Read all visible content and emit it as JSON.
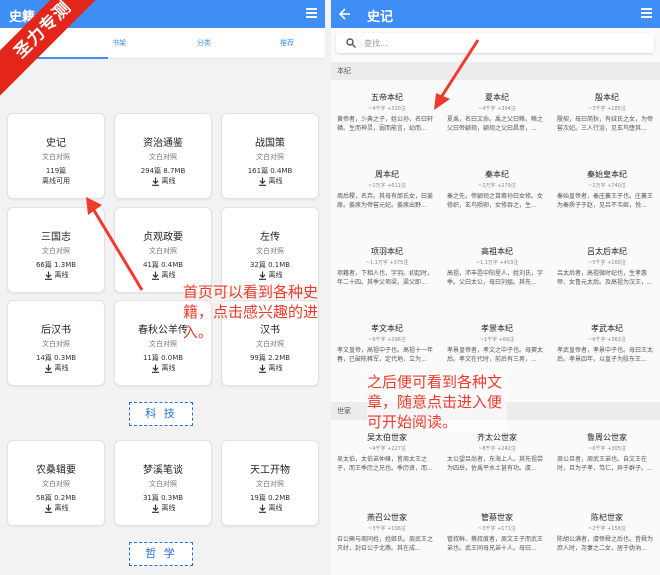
{
  "left": {
    "title": "史籍",
    "tabs": [
      "书架",
      "分类",
      "推荐"
    ],
    "banner": "圣力专测",
    "cards": [
      {
        "title": "史记",
        "sub": "文白对照",
        "size": "119篇",
        "status": "离线可用"
      },
      {
        "title": "资治通鉴",
        "sub": "文白对照",
        "size": "294篇 8.7MB",
        "status": "离线"
      },
      {
        "title": "战国策",
        "sub": "文白对照",
        "size": "161篇 0.4MB",
        "status": "离线"
      },
      {
        "title": "三国志",
        "sub": "文白对照",
        "size": "66篇 1.3MB",
        "status": "离线"
      },
      {
        "title": "贞观政要",
        "sub": "文白对照",
        "size": "41篇 0.4MB",
        "status": "离线"
      },
      {
        "title": "左传",
        "sub": "文白对照",
        "size": "32篇 0.1MB",
        "status": "离线"
      },
      {
        "title": "后汉书",
        "sub": "文白对照",
        "size": "14篇 0.3MB",
        "status": "离线"
      },
      {
        "title": "春秋公羊传",
        "sub": "文白对照",
        "size": "11篇 0.0MB",
        "status": "离线"
      },
      {
        "title": "汉书",
        "sub": "文白对照",
        "size": "99篇 2.2MB",
        "status": "离线"
      },
      {
        "title": "农桑辑要",
        "sub": "文白对照",
        "size": "58篇 0.2MB",
        "status": "离线"
      },
      {
        "title": "梦溪笔谈",
        "sub": "文白对照",
        "size": "31篇 0.3MB",
        "status": "离线"
      },
      {
        "title": "天工开物",
        "sub": "文白对照",
        "size": "19篇 0.2MB",
        "status": "离线"
      }
    ],
    "section_tech": "科 技",
    "section_phil": "哲 学",
    "annotation": "首页可以看到各种史籍，点击感兴趣的进入。"
  },
  "right": {
    "title": "史记",
    "search_placeholder": "查找...",
    "section_benji": "本纪",
    "section_shijia": "世家",
    "annotation": "之后便可看到各种文章，随意点击进入便可开始阅读。",
    "benji": [
      {
        "title": "五帝本纪",
        "meta": "~4千字 +320注",
        "excerpt": "黄帝者，少典之子，姓公孙，名曰轩辕。生而神灵，弱而能言，幼而..."
      },
      {
        "title": "夏本纪",
        "meta": "~4千字 +304注",
        "excerpt": "夏禹，名曰文命。禹之父曰鲧，鲧之父曰帝颛顼，颛顼之父曰昌意，..."
      },
      {
        "title": "殷本纪",
        "meta": "~3千字 +185注",
        "excerpt": "殷契，母曰简狄，有娀氏之女，为帝喾次妃。三人行浴，见玄鸟堕其..."
      },
      {
        "title": "周本纪",
        "meta": "~1万字 +611注",
        "excerpt": "周后稷，名弃。其母有邰氏女，曰姜原。姜原为帝喾元妃。姜原出野..."
      },
      {
        "title": "秦本纪",
        "meta": "~1万字 +279注",
        "excerpt": "秦之先，帝颛顼之苗裔孙曰女修。女修织，玄鸟陨卵，女修吞之，生..."
      },
      {
        "title": "秦始皇本纪",
        "meta": "~2万字 +740注",
        "excerpt": "秦始皇帝者，秦庄襄王子也。庄襄王为秦质子于赵，见吕不韦姬，悦..."
      },
      {
        "title": "项羽本纪",
        "meta": "~1.1万字 +375注",
        "excerpt": "项籍者，下相人也，字羽。初起时，年二十四。其季父项梁，梁父即..."
      },
      {
        "title": "高祖本纪",
        "meta": "~1.1万字 +453注",
        "excerpt": "高祖，沛丰邑中阳里人，姓刘氏，字季。父曰太公，母曰刘媪。其先..."
      },
      {
        "title": "吕太后本纪",
        "meta": "~5千字 +160注",
        "excerpt": "吕太后者，高祖微时妃也，生孝惠帝、女鲁元太后。及高祖为汉王，..."
      },
      {
        "title": "孝文本纪",
        "meta": "~6千字 +296注",
        "excerpt": "孝文皇帝，高祖中子也。高祖十一年春，已破陈豨军，定代地，立为..."
      },
      {
        "title": "孝景本纪",
        "meta": "~1千字 +66注",
        "excerpt": "孝景皇帝者，孝文之中子也。母窦太后。孝文在代时，前后有三男，..."
      },
      {
        "title": "孝武本纪",
        "meta": "~6千字 +363注",
        "excerpt": "孝武皇帝者，孝景中子也。母曰王太后。孝景四年，以皇子为胶东王..."
      }
    ],
    "shijia": [
      {
        "title": "吴太伯世家",
        "meta": "~4千字 +227注",
        "excerpt": "吴太伯，太伯弟仲雍，皆周太王之子，而王季历之兄也。季历贤，而..."
      },
      {
        "title": "齐太公世家",
        "meta": "~8千字 +242注",
        "excerpt": "太公望吕尚者，东海上人。其先祖尝为四岳，佐禹平水土甚有功。虞..."
      },
      {
        "title": "鲁周公世家",
        "meta": "~6千字 +305注",
        "excerpt": "周公旦者，周武王弟也。自文王在时，旦为子孝，笃仁，异于群子。..."
      },
      {
        "title": "燕召公世家",
        "meta": "~3千字 +106注",
        "excerpt": "召公奭与周同姓，姓姬氏。周武王之灭纣，封召公于北燕。其在成..."
      },
      {
        "title": "管蔡世家",
        "meta": "~3千字 +171注",
        "excerpt": "管叔鲜、蔡叔度者，周文王子而武王弟也。武王同母兄弟十人。母曰..."
      },
      {
        "title": "陈杞世家",
        "meta": "~2千字 +158注",
        "excerpt": "陈胡公满者，虞帝舜之后也。昔舜为庶人时，尧妻之二女，居于妫汭..."
      }
    ]
  }
}
